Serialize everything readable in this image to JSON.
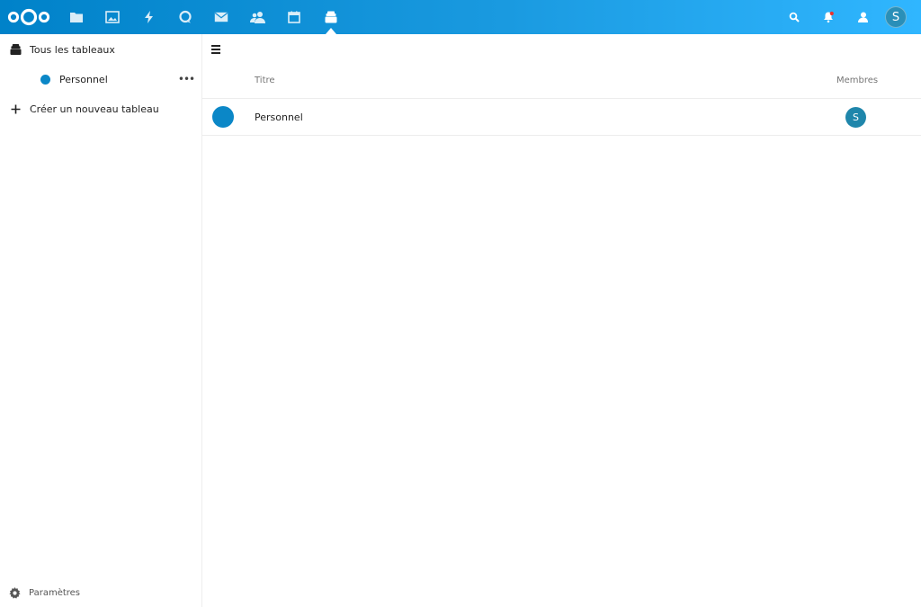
{
  "header": {
    "apps": [
      {
        "name": "files-icon"
      },
      {
        "name": "photos-icon"
      },
      {
        "name": "activity-icon"
      },
      {
        "name": "talk-icon"
      },
      {
        "name": "mail-icon"
      },
      {
        "name": "contacts-icon"
      },
      {
        "name": "calendar-icon"
      },
      {
        "name": "tables-icon"
      }
    ],
    "active_app": "tables-icon",
    "user_initial": "S",
    "colors": {
      "gradient_start": "#0082c9",
      "gradient_end": "#30b6ff"
    }
  },
  "sidebar": {
    "all_tables_label": "Tous les tableaux",
    "tables": [
      {
        "label": "Personnel",
        "color": "#0b87c7"
      }
    ],
    "more_label": "•••",
    "create_label": "Créer un nouveau tableau",
    "settings_label": "Paramètres"
  },
  "main": {
    "columns": {
      "title": "Titre",
      "members": "Membres"
    },
    "rows": [
      {
        "title": "Personnel",
        "member_initial": "S",
        "color": "#0b87c7"
      }
    ]
  }
}
